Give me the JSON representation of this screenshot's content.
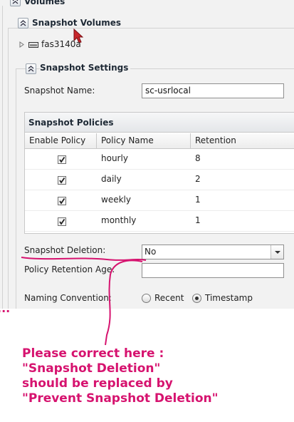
{
  "sections": {
    "volumes_title": "Volumes",
    "snapshot_volumes_title": "Snapshot Volumes",
    "snapshot_settings_title": "Snapshot Settings"
  },
  "tree": {
    "items": [
      {
        "label": "fas3140a",
        "icon": "storage-device-icon"
      }
    ]
  },
  "form": {
    "snapshot_name_label": "Snapshot Name:",
    "snapshot_name_value": "sc-usrlocal",
    "snapshot_deletion_label": "Snapshot Deletion:",
    "snapshot_deletion_value": "No",
    "policy_retention_age_label": "Policy Retention Age:",
    "policy_retention_age_value": "",
    "naming_convention_label": "Naming Convention:",
    "naming_options": [
      {
        "label": "Recent",
        "selected": false
      },
      {
        "label": "Timestamp",
        "selected": true
      }
    ]
  },
  "policies": {
    "title": "Snapshot Policies",
    "columns": [
      "Enable Policy",
      "Policy Name",
      "Retention"
    ],
    "rows": [
      {
        "enabled": true,
        "name": "hourly",
        "retention": "8"
      },
      {
        "enabled": true,
        "name": "daily",
        "retention": "2"
      },
      {
        "enabled": true,
        "name": "weekly",
        "retention": "1"
      },
      {
        "enabled": true,
        "name": "monthly",
        "retention": "1"
      }
    ]
  },
  "annotation": {
    "lines": [
      "Please correct here :",
      "\"Snapshot Deletion\"",
      "should be replaced by",
      "\"Prevent Snapshot Deletion\""
    ],
    "leader_marks": "..."
  },
  "colors": {
    "annotation": "#d6136f",
    "panel_background": "#f2f2f2",
    "cursor": "#c8262b"
  }
}
